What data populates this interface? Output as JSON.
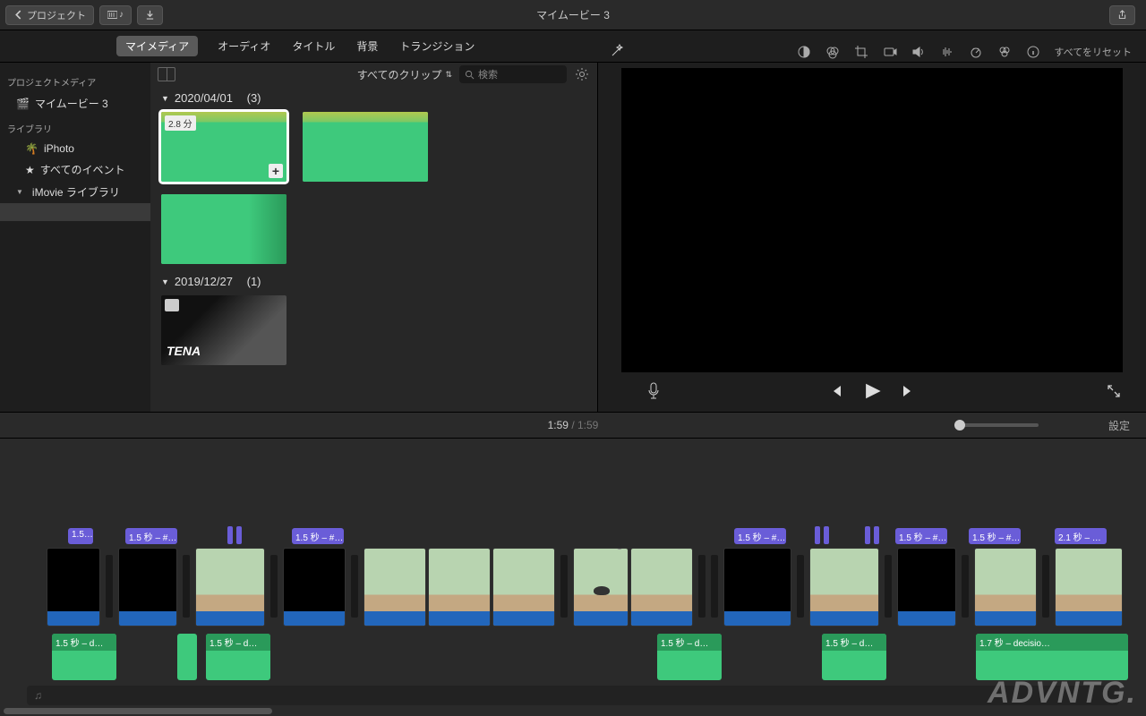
{
  "toolbar": {
    "back_label": "プロジェクト",
    "title": "マイムービー 3"
  },
  "tabs": {
    "my_media": "マイメディア",
    "audio": "オーディオ",
    "titles": "タイトル",
    "backgrounds": "背景",
    "transitions": "トランジション"
  },
  "browser_bar": {
    "filter": "すべてのクリップ",
    "search_placeholder": "検索"
  },
  "sidebar": {
    "project_media_head": "プロジェクトメディア",
    "project_name": "マイムービー 3",
    "library_head": "ライブラリ",
    "iphoto": "iPhoto",
    "all_events": "すべてのイベント",
    "imovie_library": "iMovie ライブラリ"
  },
  "events": [
    {
      "title": "2020/04/01",
      "count": "(3)",
      "clips": [
        {
          "duration": "2.8 分",
          "selected": true,
          "add": true
        },
        {
          "duration": ""
        },
        {
          "duration": ""
        }
      ]
    },
    {
      "title": "2019/12/27",
      "count": "(1)",
      "photo": true,
      "brand": "TENA"
    }
  ],
  "adjust": {
    "reset": "すべてをリセット"
  },
  "time": {
    "current": "1:59",
    "total": "1:59",
    "settings": "設定"
  },
  "timeline": {
    "titles": [
      "1.5…",
      "1.5 秒 – #…",
      "1.5 秒 – #…",
      "1.5 秒 – #…",
      "1.5 秒 – #…",
      "1.5 秒 – #…",
      "2.1 秒 – …"
    ],
    "audios": [
      "1.5 秒 – d…",
      "1.5 秒 – d…",
      "1.5 秒 – d…",
      "1.5 秒 – d…",
      "1.7 秒 – decisio…"
    ]
  },
  "watermark": "ADVNTG."
}
